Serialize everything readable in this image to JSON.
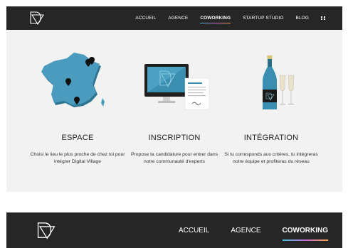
{
  "nav": {
    "logo": "digital-village-logo",
    "items": [
      {
        "label": "ACCUEIL"
      },
      {
        "label": "AGENCE"
      },
      {
        "label": "COWORKING",
        "active": true
      },
      {
        "label": "STARTUP STUDIO"
      },
      {
        "label": "BLOG"
      }
    ],
    "menu_icon": "grid-icon"
  },
  "features": [
    {
      "icon": "france-map-icon",
      "title": "ESPACE",
      "text": "Choisi le lieu le plus proche de chez toi pour intégrer Digital Village"
    },
    {
      "icon": "monitor-document-icon",
      "title": "INSCRIPTION",
      "text": "Propose ta candidature pour entrer dans notre communauté d'experts"
    },
    {
      "icon": "champagne-icon",
      "title": "INTÉGRATION",
      "text": "Si tu corresponds aux critères, tu intègreras notre équipe et profiteras du réseau"
    }
  ],
  "sticky_nav": {
    "items": [
      {
        "label": "ACCUEIL"
      },
      {
        "label": "AGENCE"
      },
      {
        "label": "COWORKING",
        "active": true
      }
    ]
  },
  "colors": {
    "nav_bg": "#262626",
    "panel_bg": "#f2f2f2",
    "accent_blue": "#3a8fb0",
    "active_gradient": [
      "#3ec1d3",
      "#c56bd6",
      "#f0a24b"
    ]
  }
}
